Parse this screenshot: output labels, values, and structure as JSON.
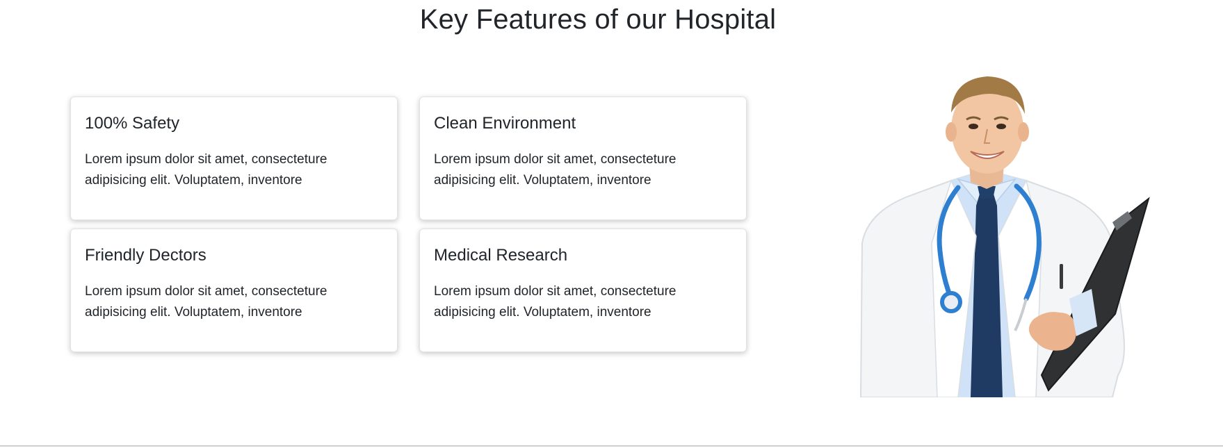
{
  "section": {
    "title": "Key Features of our Hospital"
  },
  "features": [
    {
      "title": "100% Safety",
      "text": "Lorem ipsum dolor sit amet, consecteture adipisicing elit. Voluptatem, inventore"
    },
    {
      "title": "Clean Environment",
      "text": "Lorem ipsum dolor sit amet, consecteture adipisicing elit. Voluptatem, inventore"
    },
    {
      "title": "Friendly Dectors",
      "text": "Lorem ipsum dolor sit amet, consecteture adipisicing elit. Voluptatem, inventore"
    },
    {
      "title": "Medical Research",
      "text": "Lorem ipsum dolor sit amet, consecteture adipisicing elit. Voluptatem, inventore"
    }
  ],
  "colors": {
    "text": "#212529",
    "card_border": "#e3e3e3",
    "stethoscope": "#2f7fd1",
    "tie": "#1f3a63",
    "shirt": "#cfe2f7",
    "coat": "#f4f6f8"
  }
}
